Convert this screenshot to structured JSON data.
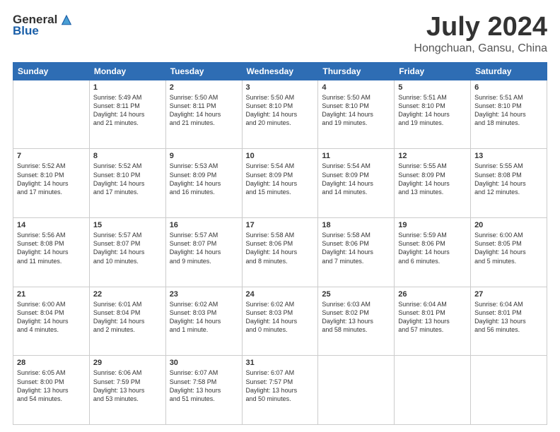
{
  "logo": {
    "general": "General",
    "blue": "Blue"
  },
  "title": "July 2024",
  "subtitle": "Hongchuan, Gansu, China",
  "headers": [
    "Sunday",
    "Monday",
    "Tuesday",
    "Wednesday",
    "Thursday",
    "Friday",
    "Saturday"
  ],
  "weeks": [
    [
      {
        "day": "",
        "info": ""
      },
      {
        "day": "1",
        "info": "Sunrise: 5:49 AM\nSunset: 8:11 PM\nDaylight: 14 hours\nand 21 minutes."
      },
      {
        "day": "2",
        "info": "Sunrise: 5:50 AM\nSunset: 8:11 PM\nDaylight: 14 hours\nand 21 minutes."
      },
      {
        "day": "3",
        "info": "Sunrise: 5:50 AM\nSunset: 8:10 PM\nDaylight: 14 hours\nand 20 minutes."
      },
      {
        "day": "4",
        "info": "Sunrise: 5:50 AM\nSunset: 8:10 PM\nDaylight: 14 hours\nand 19 minutes."
      },
      {
        "day": "5",
        "info": "Sunrise: 5:51 AM\nSunset: 8:10 PM\nDaylight: 14 hours\nand 19 minutes."
      },
      {
        "day": "6",
        "info": "Sunrise: 5:51 AM\nSunset: 8:10 PM\nDaylight: 14 hours\nand 18 minutes."
      }
    ],
    [
      {
        "day": "7",
        "info": "Sunrise: 5:52 AM\nSunset: 8:10 PM\nDaylight: 14 hours\nand 17 minutes."
      },
      {
        "day": "8",
        "info": "Sunrise: 5:52 AM\nSunset: 8:10 PM\nDaylight: 14 hours\nand 17 minutes."
      },
      {
        "day": "9",
        "info": "Sunrise: 5:53 AM\nSunset: 8:09 PM\nDaylight: 14 hours\nand 16 minutes."
      },
      {
        "day": "10",
        "info": "Sunrise: 5:54 AM\nSunset: 8:09 PM\nDaylight: 14 hours\nand 15 minutes."
      },
      {
        "day": "11",
        "info": "Sunrise: 5:54 AM\nSunset: 8:09 PM\nDaylight: 14 hours\nand 14 minutes."
      },
      {
        "day": "12",
        "info": "Sunrise: 5:55 AM\nSunset: 8:09 PM\nDaylight: 14 hours\nand 13 minutes."
      },
      {
        "day": "13",
        "info": "Sunrise: 5:55 AM\nSunset: 8:08 PM\nDaylight: 14 hours\nand 12 minutes."
      }
    ],
    [
      {
        "day": "14",
        "info": "Sunrise: 5:56 AM\nSunset: 8:08 PM\nDaylight: 14 hours\nand 11 minutes."
      },
      {
        "day": "15",
        "info": "Sunrise: 5:57 AM\nSunset: 8:07 PM\nDaylight: 14 hours\nand 10 minutes."
      },
      {
        "day": "16",
        "info": "Sunrise: 5:57 AM\nSunset: 8:07 PM\nDaylight: 14 hours\nand 9 minutes."
      },
      {
        "day": "17",
        "info": "Sunrise: 5:58 AM\nSunset: 8:06 PM\nDaylight: 14 hours\nand 8 minutes."
      },
      {
        "day": "18",
        "info": "Sunrise: 5:58 AM\nSunset: 8:06 PM\nDaylight: 14 hours\nand 7 minutes."
      },
      {
        "day": "19",
        "info": "Sunrise: 5:59 AM\nSunset: 8:06 PM\nDaylight: 14 hours\nand 6 minutes."
      },
      {
        "day": "20",
        "info": "Sunrise: 6:00 AM\nSunset: 8:05 PM\nDaylight: 14 hours\nand 5 minutes."
      }
    ],
    [
      {
        "day": "21",
        "info": "Sunrise: 6:00 AM\nSunset: 8:04 PM\nDaylight: 14 hours\nand 4 minutes."
      },
      {
        "day": "22",
        "info": "Sunrise: 6:01 AM\nSunset: 8:04 PM\nDaylight: 14 hours\nand 2 minutes."
      },
      {
        "day": "23",
        "info": "Sunrise: 6:02 AM\nSunset: 8:03 PM\nDaylight: 14 hours\nand 1 minute."
      },
      {
        "day": "24",
        "info": "Sunrise: 6:02 AM\nSunset: 8:03 PM\nDaylight: 14 hours\nand 0 minutes."
      },
      {
        "day": "25",
        "info": "Sunrise: 6:03 AM\nSunset: 8:02 PM\nDaylight: 13 hours\nand 58 minutes."
      },
      {
        "day": "26",
        "info": "Sunrise: 6:04 AM\nSunset: 8:01 PM\nDaylight: 13 hours\nand 57 minutes."
      },
      {
        "day": "27",
        "info": "Sunrise: 6:04 AM\nSunset: 8:01 PM\nDaylight: 13 hours\nand 56 minutes."
      }
    ],
    [
      {
        "day": "28",
        "info": "Sunrise: 6:05 AM\nSunset: 8:00 PM\nDaylight: 13 hours\nand 54 minutes."
      },
      {
        "day": "29",
        "info": "Sunrise: 6:06 AM\nSunset: 7:59 PM\nDaylight: 13 hours\nand 53 minutes."
      },
      {
        "day": "30",
        "info": "Sunrise: 6:07 AM\nSunset: 7:58 PM\nDaylight: 13 hours\nand 51 minutes."
      },
      {
        "day": "31",
        "info": "Sunrise: 6:07 AM\nSunset: 7:57 PM\nDaylight: 13 hours\nand 50 minutes."
      },
      {
        "day": "",
        "info": ""
      },
      {
        "day": "",
        "info": ""
      },
      {
        "day": "",
        "info": ""
      }
    ]
  ]
}
